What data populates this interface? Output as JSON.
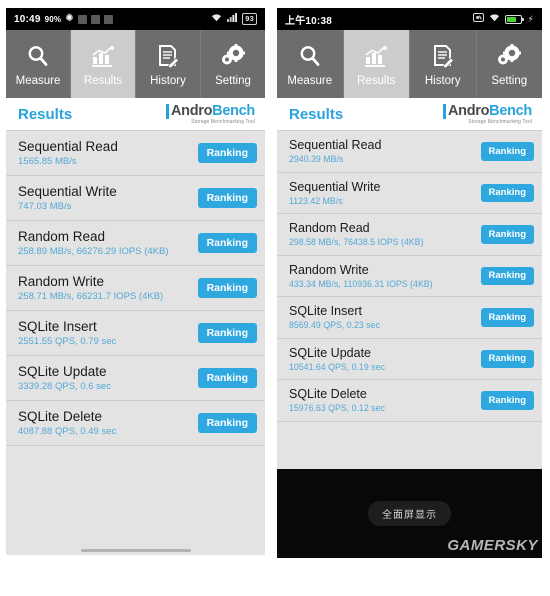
{
  "tabs": [
    {
      "label": "Measure",
      "icon": "search-icon",
      "active": false
    },
    {
      "label": "Results",
      "icon": "bar-chart-icon",
      "active": true
    },
    {
      "label": "History",
      "icon": "document-pen-icon",
      "active": false
    },
    {
      "label": "Setting",
      "icon": "gears-icon",
      "active": false
    }
  ],
  "logo": {
    "andro": "Andro",
    "bench": "Bench",
    "tagline": "Storage Benchmarking Tool"
  },
  "colors": {
    "accent_blue": "#29a3dc",
    "button_blue": "#2fa8e0",
    "subtext_blue": "#52a8d6",
    "list_bg": "#e3e3e3",
    "tabbar_bg": "#6d6d6d",
    "tab_active_bg": "#cccccc",
    "battery_green": "#4cd137"
  },
  "left_phone": {
    "statusbar": {
      "time": "10:49",
      "battery_percent": "90%",
      "icons": [
        "snowflake-icon",
        "app-box-icon",
        "app-box-icon",
        "app-box-icon"
      ],
      "right_icons": [
        "wifi-icon",
        "signal-icon"
      ],
      "battery_label": "93"
    },
    "header": {
      "title": "Results"
    },
    "results": [
      {
        "name": "Sequential Read",
        "value": "1565.85 MB/s",
        "button": "Ranking"
      },
      {
        "name": "Sequential Write",
        "value": "747.03 MB/s",
        "button": "Ranking"
      },
      {
        "name": "Random Read",
        "value": "258.89 MB/s, 66276.29 IOPS (4KB)",
        "button": "Ranking"
      },
      {
        "name": "Random Write",
        "value": "258.71 MB/s, 66231.7 IOPS (4KB)",
        "button": "Ranking"
      },
      {
        "name": "SQLite Insert",
        "value": "2551.55 QPS, 0.79 sec",
        "button": "Ranking"
      },
      {
        "name": "SQLite Update",
        "value": "3339.28 QPS, 0.6 sec",
        "button": "Ranking"
      },
      {
        "name": "SQLite Delete",
        "value": "4087.88 QPS, 0.49 sec",
        "button": "Ranking"
      }
    ]
  },
  "right_phone": {
    "statusbar": {
      "time": "上午10:38",
      "right_icons": [
        "mute-icon",
        "wifi-icon",
        "battery-icon",
        "charging-bolt-icon"
      ]
    },
    "header": {
      "title": "Results"
    },
    "results": [
      {
        "name": "Sequential Read",
        "value": "2940.39 MB/s",
        "button": "Ranking"
      },
      {
        "name": "Sequential Write",
        "value": "1123.42 MB/s",
        "button": "Ranking"
      },
      {
        "name": "Random Read",
        "value": "298.58 MB/s, 76438.5 IOPS (4KB)",
        "button": "Ranking"
      },
      {
        "name": "Random Write",
        "value": "433.34 MB/s, 110936.31 IOPS (4KB)",
        "button": "Ranking"
      },
      {
        "name": "SQLite Insert",
        "value": "8569.49 QPS, 0.23 sec",
        "button": "Ranking"
      },
      {
        "name": "SQLite Update",
        "value": "10541.64 QPS, 0.19 sec",
        "button": "Ranking"
      },
      {
        "name": "SQLite Delete",
        "value": "15976.63 QPS, 0.12 sec",
        "button": "Ranking"
      }
    ],
    "fullscreen_pill": "全面屏显示",
    "watermark": "GAMERSKY"
  }
}
